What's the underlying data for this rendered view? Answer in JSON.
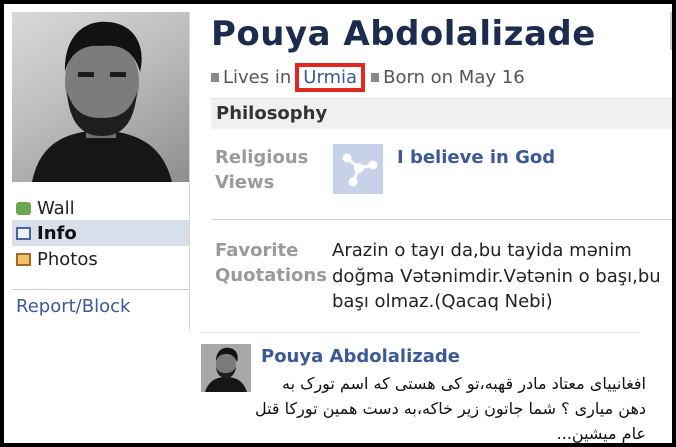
{
  "profile": {
    "name": "Pouya Abdolalizade",
    "lives_in_label": "Lives in",
    "city": "Urmia",
    "born": "Born on May 16"
  },
  "nav": {
    "items": [
      {
        "label": "Wall",
        "icon": "wall-icon"
      },
      {
        "label": "Info",
        "icon": "info-icon"
      },
      {
        "label": "Photos",
        "icon": "photos-icon"
      }
    ],
    "active": "Info",
    "report_block": "Report/Block"
  },
  "philosophy": {
    "title": "Philosophy",
    "religious_views_label": [
      "Religious",
      "Views"
    ],
    "religious_views_value": "I believe in God",
    "favorite_quotations_label": [
      "Favorite",
      "Quotations"
    ],
    "favorite_quotations_value": "Arazin o tayı da,bu tayida mənim doğma Vətənimdir.Vətənin o başı,bu başı olmaz.(Qacaq Nebi)"
  },
  "post": {
    "author": "Pouya Abdolalizade",
    "text": "افغانییای معتاد مادر قهبه،تو کی هستی که اسم تورک به دهن میاری ؟ شما جاتون زیر خاکه،به دست همین تورکا قتل عام میشین..."
  },
  "colors": {
    "link": "#3b5998",
    "name": "#1c2c4e",
    "highlight": "#e3271d",
    "active_nav": "#d8dfea"
  }
}
